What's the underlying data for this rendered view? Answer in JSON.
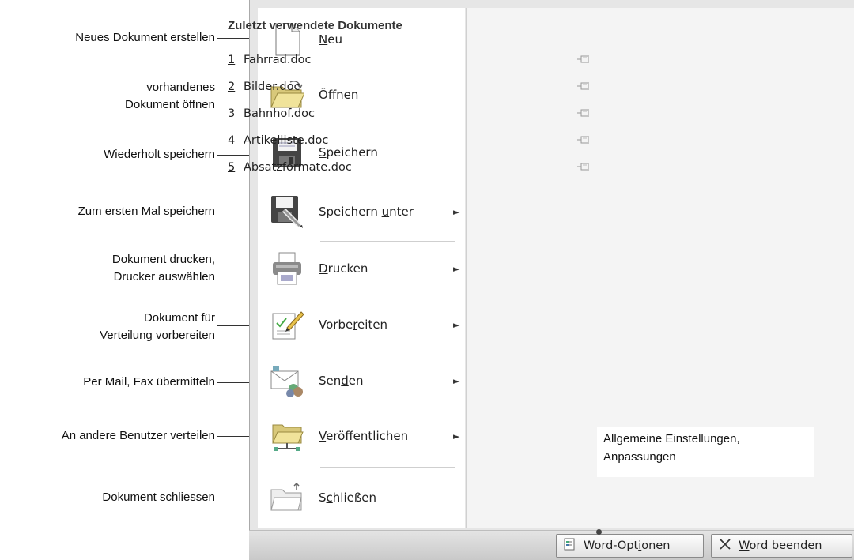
{
  "annotations": [
    {
      "lines": [
        "Neues Dokument erstellen"
      ]
    },
    {
      "lines": [
        "vorhandenes",
        "Dokument öffnen"
      ]
    },
    {
      "lines": [
        "Wiederholt speichern"
      ]
    },
    {
      "lines": [
        "Zum ersten Mal speichern"
      ]
    },
    {
      "lines": [
        "Dokument drucken,",
        "Drucker auswählen"
      ]
    },
    {
      "lines": [
        "Dokument für",
        "Verteilung vorbereiten"
      ]
    },
    {
      "lines": [
        "Per Mail, Fax übermitteln"
      ]
    },
    {
      "lines": [
        "An andere Benutzer verteilen"
      ]
    },
    {
      "lines": [
        "Dokument schliessen"
      ]
    }
  ],
  "menu": {
    "items": [
      {
        "pre": "",
        "key": "N",
        "post": "eu",
        "icon": "new-document-icon",
        "submenu": false
      },
      {
        "pre": "Ö",
        "key": "f",
        "post": "fnen",
        "icon": "open-folder-icon",
        "submenu": false
      },
      {
        "pre": "",
        "key": "S",
        "post": "peichern",
        "icon": "floppy-disk-icon",
        "submenu": false
      },
      {
        "pre": "Speichern ",
        "key": "u",
        "post": "nter",
        "icon": "save-as-icon",
        "submenu": true
      },
      {
        "pre": "",
        "key": "D",
        "post": "rucken",
        "icon": "printer-icon",
        "submenu": true
      },
      {
        "pre": "Vorbe",
        "key": "r",
        "post": "eiten",
        "icon": "prepare-document-icon",
        "submenu": true
      },
      {
        "pre": "Sen",
        "key": "d",
        "post": "en",
        "icon": "send-mail-icon",
        "submenu": true
      },
      {
        "pre": "",
        "key": "V",
        "post": "eröffentlichen",
        "icon": "publish-folder-icon",
        "submenu": true
      },
      {
        "pre": "S",
        "key": "c",
        "post": "hließen",
        "icon": "close-folder-icon",
        "submenu": false
      }
    ],
    "submenu_arrow": "►"
  },
  "recent": {
    "title": "Zuletzt verwendete Dokumente",
    "pin_icon": "pin-icon",
    "items": [
      {
        "num": "1",
        "name": "Fahrrad.doc"
      },
      {
        "num": "2",
        "name": "Bilder.doc"
      },
      {
        "num": "3",
        "name": "Bahnhof.doc"
      },
      {
        "num": "4",
        "name": "Artikelliste.doc"
      },
      {
        "num": "5",
        "name": "Absatzformate.doc"
      }
    ]
  },
  "callout": {
    "lines": [
      "Allgemeine Einstellungen,",
      "Anpassungen"
    ]
  },
  "buttons": {
    "options": {
      "pre": "Word-Opt",
      "key": "i",
      "post": "onen"
    },
    "exit": {
      "pre": "",
      "key": "W",
      "post": "ord beenden"
    }
  }
}
